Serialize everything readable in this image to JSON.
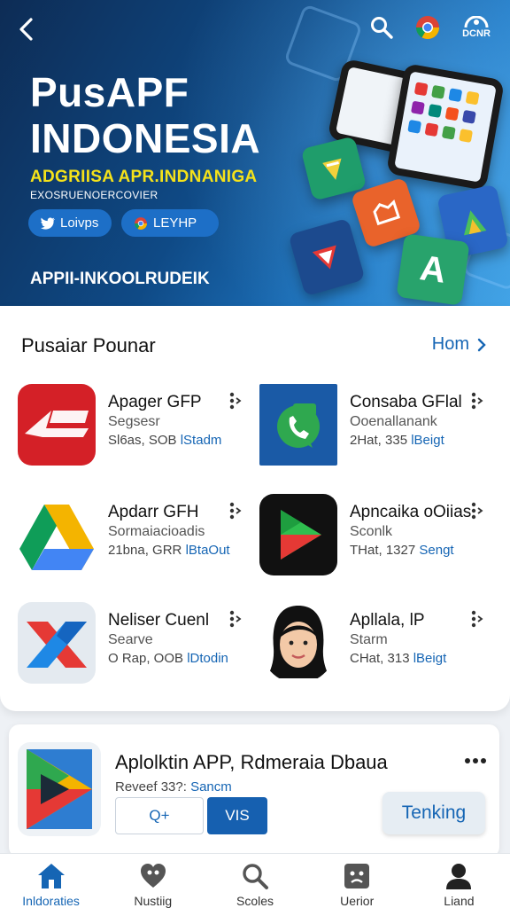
{
  "hero": {
    "title_line1": "PusAPF",
    "title_line2": "INDONESIA",
    "tagline": "ADGRIISA APR.INDNANIGA",
    "subtitle": "EXOSRUENOERCOVIER",
    "pill_1": "Loivps",
    "pill_2": "LEYHP",
    "badge": "DCNR",
    "footer": "APPII-INKOOLRUDEIK",
    "tile_letter": "A"
  },
  "popular": {
    "title": "Pusaiar Pounar",
    "more": "Hom",
    "apps": [
      {
        "name": "Apager GFP",
        "category": "Segsesr",
        "rating": "Sl6as, SOB",
        "tag": "lStadm",
        "icon": "app-logo-icon"
      },
      {
        "name": "Consaba GFlal",
        "category": "Ooenallanank",
        "rating": "2Hat, 335",
        "tag": "lBeigt",
        "icon": "phone-chat-icon"
      },
      {
        "name": "Apdarr GFH",
        "category": "Sormaiacioadis",
        "rating": "21bna, GRR",
        "tag": "lBtaOut",
        "icon": "drive-triangle-icon"
      },
      {
        "name": "Apncaika oOiias",
        "category": "Sconlk",
        "rating": "THat, 1327",
        "tag": "Sengt",
        "icon": "play-triangle-icon"
      },
      {
        "name": "Neliser Cuenl",
        "category": "Searve",
        "rating": "O Rap, OOB",
        "tag": "lDtodin",
        "icon": "x-logo-icon"
      },
      {
        "name": "Apllala, lP",
        "category": "Starm",
        "rating": "CHat, 313",
        "tag": "lBeigt",
        "icon": "avatar-woman-icon"
      }
    ]
  },
  "featured": {
    "name": "Aplolktin APP, Rdmeraia Dbaua",
    "meta": "Reveef 33?:",
    "tag": "Sancm",
    "btn_outline": "Q+",
    "btn_fill": "VIS",
    "btn_soft": "Tenking"
  },
  "nav": {
    "items": [
      {
        "label": "Inldoraties",
        "icon": "home-icon",
        "active": true
      },
      {
        "label": "Nustiig",
        "icon": "heart-icon",
        "active": false
      },
      {
        "label": "Scoles",
        "icon": "search-icon",
        "active": false
      },
      {
        "label": "Uerior",
        "icon": "face-icon",
        "active": false
      },
      {
        "label": "Liand",
        "icon": "person-icon",
        "active": false
      }
    ]
  },
  "colors": {
    "accent": "#1565b4",
    "hero_yellow": "#f5e21a",
    "hero_dark": "#0d2c55"
  }
}
